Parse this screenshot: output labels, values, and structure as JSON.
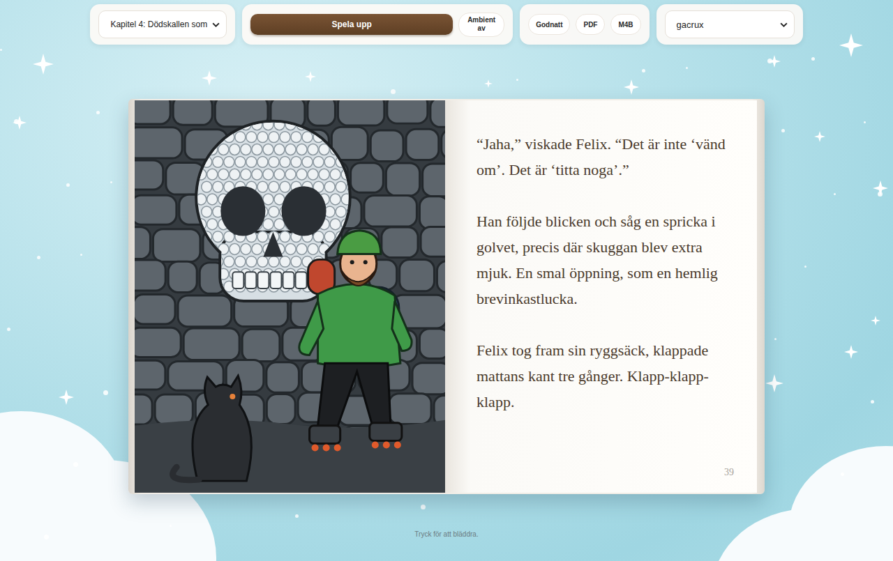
{
  "toolbar": {
    "chapter_select": {
      "value": "Kapitel 4: Dödskallen som"
    },
    "play_button": "Spela upp",
    "ambient_toggle": "Ambient av",
    "export_buttons": [
      "Godnatt",
      "PDF",
      "M4B"
    ],
    "voice_select": {
      "value": "gacrux"
    }
  },
  "book": {
    "paragraphs": [
      "“Jaha,” viskade Felix. “Det är inte ‘vänd om’. Det är ‘titta noga’.”",
      "Han följde blicken och såg en spricka i golvet, precis där skuggan blev extra mjuk. En smal öppning, som en hemlig brevinkastlucka.",
      "Felix tog fram sin ryggsäck, klappade mattans kant tre gånger. Klapp-klapp-klapp."
    ],
    "page_number": "39"
  },
  "hint": "Tryck för att bläddra."
}
